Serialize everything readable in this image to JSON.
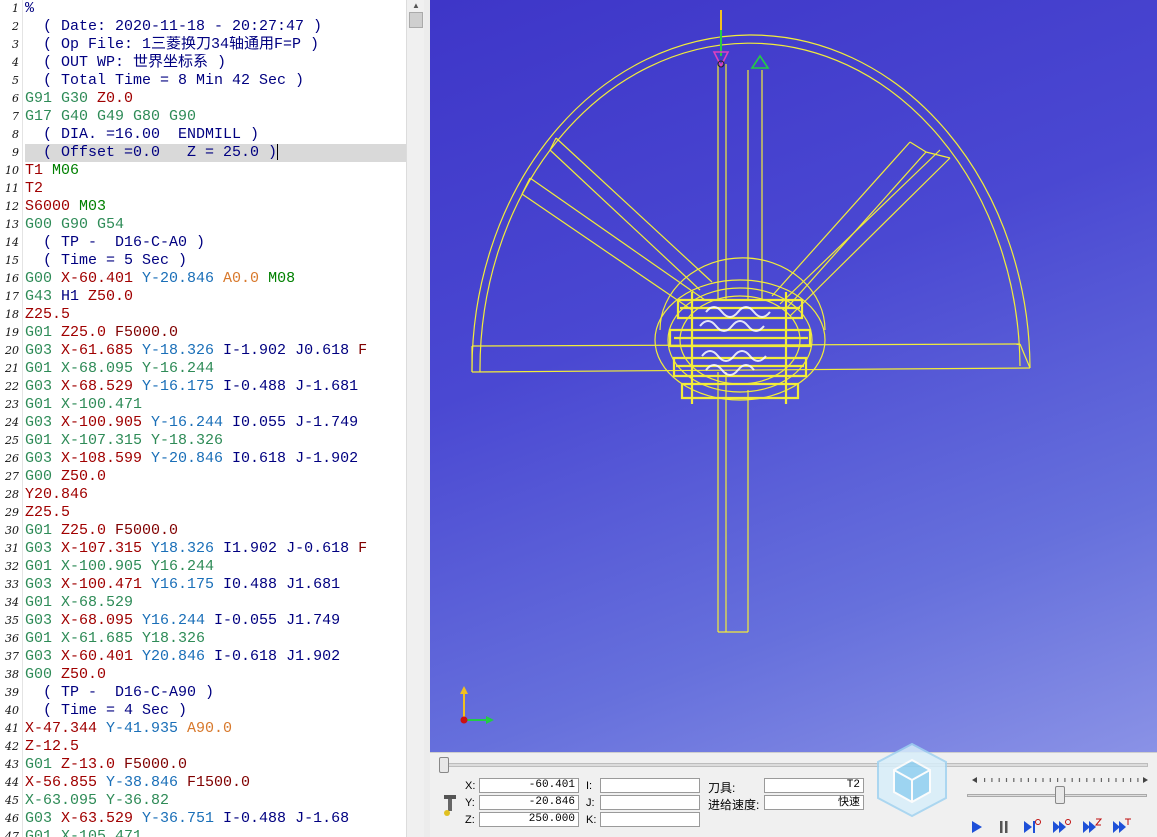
{
  "editor": {
    "lines": [
      {
        "n": "1",
        "t": [
          [
            "%",
            "plain"
          ]
        ]
      },
      {
        "n": "2",
        "t": [
          [
            "  ( Date: 2020-11-18 - 20:27:47 )",
            "comment"
          ]
        ]
      },
      {
        "n": "3",
        "t": [
          [
            "  ( Op File: 1三菱换刀34轴通用F=P )",
            "comment"
          ]
        ]
      },
      {
        "n": "4",
        "t": [
          [
            "  ( OUT WP: 世界坐标系 )",
            "comment"
          ]
        ]
      },
      {
        "n": "5",
        "t": [
          [
            "  ( Total Time = 8 Min 42 Sec )",
            "comment"
          ]
        ]
      },
      {
        "n": "6",
        "t": [
          [
            "G91 G30 ",
            "g"
          ],
          [
            "Z0.0",
            "z"
          ]
        ]
      },
      {
        "n": "7",
        "t": [
          [
            "G17 G40 G49 G80 G90",
            "g"
          ]
        ]
      },
      {
        "n": "8",
        "t": [
          [
            "  ( DIA. =16.00  ENDMILL )",
            "comment"
          ]
        ]
      },
      {
        "n": "9",
        "t": [
          [
            "  ( Offset =0.0   Z = 25.0 )",
            "comment"
          ]
        ],
        "current": true
      },
      {
        "n": "10",
        "t": [
          [
            "T1 ",
            "t"
          ],
          [
            "M06",
            "m"
          ]
        ]
      },
      {
        "n": "11",
        "t": [
          [
            "T2",
            "t"
          ]
        ]
      },
      {
        "n": "12",
        "t": [
          [
            "S6000 ",
            "s"
          ],
          [
            "M03",
            "m"
          ]
        ]
      },
      {
        "n": "13",
        "t": [
          [
            "G00 G90 G54",
            "g"
          ]
        ]
      },
      {
        "n": "14",
        "t": [
          [
            "  ( TP -  D16-C-A0 )",
            "comment"
          ]
        ]
      },
      {
        "n": "15",
        "t": [
          [
            "  ( Time = 5 Sec )",
            "comment"
          ]
        ]
      },
      {
        "n": "16",
        "t": [
          [
            "G00 ",
            "g"
          ],
          [
            "X-60.401 ",
            "x"
          ],
          [
            "Y-20.846 ",
            "y"
          ],
          [
            "A0.0 ",
            "a"
          ],
          [
            "M08",
            "m"
          ]
        ]
      },
      {
        "n": "17",
        "t": [
          [
            "G43 ",
            "g"
          ],
          [
            "H1 ",
            "h"
          ],
          [
            "Z50.0",
            "z"
          ]
        ]
      },
      {
        "n": "18",
        "t": [
          [
            "Z25.5",
            "z"
          ]
        ]
      },
      {
        "n": "19",
        "t": [
          [
            "G01 ",
            "g"
          ],
          [
            "Z25.0 ",
            "z"
          ],
          [
            "F5000.0",
            "f"
          ]
        ]
      },
      {
        "n": "20",
        "t": [
          [
            "G03 ",
            "g"
          ],
          [
            "X-61.685 ",
            "x"
          ],
          [
            "Y-18.326 ",
            "y"
          ],
          [
            "I-1.902 ",
            "i"
          ],
          [
            "J0.618 ",
            "j"
          ],
          [
            "F",
            "f"
          ]
        ]
      },
      {
        "n": "21",
        "t": [
          [
            "G01 ",
            "g"
          ],
          [
            "X-68.095 ",
            "v"
          ],
          [
            "Y-16.244",
            "v"
          ]
        ]
      },
      {
        "n": "22",
        "t": [
          [
            "G03 ",
            "g"
          ],
          [
            "X-68.529 ",
            "x"
          ],
          [
            "Y-16.175 ",
            "y"
          ],
          [
            "I-0.488 ",
            "i"
          ],
          [
            "J-1.681",
            "j"
          ]
        ]
      },
      {
        "n": "23",
        "t": [
          [
            "G01 ",
            "g"
          ],
          [
            "X-100.471",
            "v"
          ]
        ]
      },
      {
        "n": "24",
        "t": [
          [
            "G03 ",
            "g"
          ],
          [
            "X-100.905 ",
            "x"
          ],
          [
            "Y-16.244 ",
            "y"
          ],
          [
            "I0.055 ",
            "i"
          ],
          [
            "J-1.749",
            "j"
          ]
        ]
      },
      {
        "n": "25",
        "t": [
          [
            "G01 ",
            "g"
          ],
          [
            "X-107.315 ",
            "v"
          ],
          [
            "Y-18.326",
            "v"
          ]
        ]
      },
      {
        "n": "26",
        "t": [
          [
            "G03 ",
            "g"
          ],
          [
            "X-108.599 ",
            "x"
          ],
          [
            "Y-20.846 ",
            "y"
          ],
          [
            "I0.618 ",
            "i"
          ],
          [
            "J-1.902",
            "j"
          ]
        ]
      },
      {
        "n": "27",
        "t": [
          [
            "G00 ",
            "g"
          ],
          [
            "Z50.0",
            "z"
          ]
        ]
      },
      {
        "n": "28",
        "t": [
          [
            "Y20.846",
            "x"
          ]
        ]
      },
      {
        "n": "29",
        "t": [
          [
            "Z25.5",
            "z"
          ]
        ]
      },
      {
        "n": "30",
        "t": [
          [
            "G01 ",
            "g"
          ],
          [
            "Z25.0 ",
            "z"
          ],
          [
            "F5000.0",
            "f"
          ]
        ]
      },
      {
        "n": "31",
        "t": [
          [
            "G03 ",
            "g"
          ],
          [
            "X-107.315 ",
            "x"
          ],
          [
            "Y18.326 ",
            "y"
          ],
          [
            "I1.902 ",
            "i"
          ],
          [
            "J-0.618 ",
            "j"
          ],
          [
            "F",
            "f"
          ]
        ]
      },
      {
        "n": "32",
        "t": [
          [
            "G01 ",
            "g"
          ],
          [
            "X-100.905 ",
            "v"
          ],
          [
            "Y16.244",
            "v"
          ]
        ]
      },
      {
        "n": "33",
        "t": [
          [
            "G03 ",
            "g"
          ],
          [
            "X-100.471 ",
            "x"
          ],
          [
            "Y16.175 ",
            "y"
          ],
          [
            "I0.488 ",
            "i"
          ],
          [
            "J1.681",
            "j"
          ]
        ]
      },
      {
        "n": "34",
        "t": [
          [
            "G01 ",
            "g"
          ],
          [
            "X-68.529",
            "v"
          ]
        ]
      },
      {
        "n": "35",
        "t": [
          [
            "G03 ",
            "g"
          ],
          [
            "X-68.095 ",
            "x"
          ],
          [
            "Y16.244 ",
            "y"
          ],
          [
            "I-0.055 ",
            "i"
          ],
          [
            "J1.749",
            "j"
          ]
        ]
      },
      {
        "n": "36",
        "t": [
          [
            "G01 ",
            "g"
          ],
          [
            "X-61.685 ",
            "v"
          ],
          [
            "Y18.326",
            "v"
          ]
        ]
      },
      {
        "n": "37",
        "t": [
          [
            "G03 ",
            "g"
          ],
          [
            "X-60.401 ",
            "x"
          ],
          [
            "Y20.846 ",
            "y"
          ],
          [
            "I-0.618 ",
            "i"
          ],
          [
            "J1.902",
            "j"
          ]
        ]
      },
      {
        "n": "38",
        "t": [
          [
            "G00 ",
            "g"
          ],
          [
            "Z50.0",
            "z"
          ]
        ]
      },
      {
        "n": "39",
        "t": [
          [
            "  ( TP -  D16-C-A90 )",
            "comment"
          ]
        ]
      },
      {
        "n": "40",
        "t": [
          [
            "  ( Time = 4 Sec )",
            "comment"
          ]
        ]
      },
      {
        "n": "41",
        "t": [
          [
            "X-47.344 ",
            "x"
          ],
          [
            "Y-41.935 ",
            "y"
          ],
          [
            "A90.0",
            "a"
          ]
        ]
      },
      {
        "n": "42",
        "t": [
          [
            "Z-12.5",
            "z"
          ]
        ]
      },
      {
        "n": "43",
        "t": [
          [
            "G01 ",
            "g"
          ],
          [
            "Z-13.0 ",
            "z"
          ],
          [
            "F5000.0",
            "f"
          ]
        ]
      },
      {
        "n": "44",
        "t": [
          [
            "X-56.855 ",
            "x"
          ],
          [
            "Y-38.846 ",
            "y"
          ],
          [
            "F1500.0",
            "f"
          ]
        ]
      },
      {
        "n": "45",
        "t": [
          [
            "X-63.095 ",
            "v"
          ],
          [
            "Y-36.82",
            "v"
          ]
        ]
      },
      {
        "n": "46",
        "t": [
          [
            "G03 ",
            "g"
          ],
          [
            "X-63.529 ",
            "x"
          ],
          [
            "Y-36.751 ",
            "y"
          ],
          [
            "I-0.488 ",
            "i"
          ],
          [
            "J-1.68",
            "j"
          ]
        ]
      },
      {
        "n": "47",
        "t": [
          [
            "G01 ",
            "g"
          ],
          [
            "X-105.471",
            "v"
          ]
        ]
      }
    ]
  },
  "panel": {
    "x_label": "X:",
    "y_label": "Y:",
    "z_label": "Z:",
    "i_label": "I:",
    "j_label": "J:",
    "k_label": "K:",
    "x_value": "-60.401",
    "y_value": "-20.846",
    "z_value": "250.000",
    "i_value": "",
    "j_value": "",
    "k_value": "",
    "tool_label": "刀具:",
    "tool_value": "T2",
    "feed_label": "进给速度:",
    "feed_value": "快速",
    "simulation_progress": 0.0,
    "speed_fraction": 0.52
  },
  "colors": {
    "viewport_top": "#3e36c8",
    "viewport_bottom": "#8a92e6",
    "toolpath": "#f2ec3a",
    "axis_z": "#22cc44",
    "axis_y": "#f0c020",
    "axis_x": "#22cc44",
    "tool_marker": "#e040c0",
    "current_line_bg": "#d9d9d9"
  }
}
